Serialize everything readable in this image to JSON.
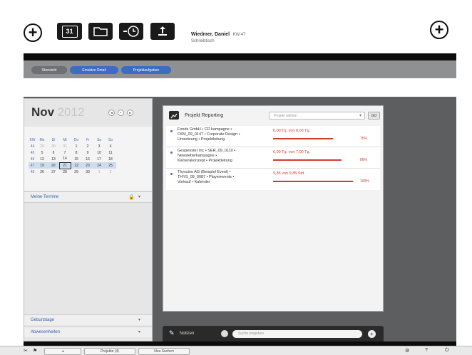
{
  "user": {
    "name": "Wiedmer, Daniel",
    "sub": "Schreibtisch",
    "tag": "KW 47"
  },
  "toolbar": {
    "calendar_day": "31"
  },
  "pills": [
    "Übersicht",
    "Einsätze Detail",
    "Projektaufgaben"
  ],
  "calendar": {
    "month": "Nov",
    "year": "2012",
    "headers": [
      "KW",
      "Mo",
      "Di",
      "Mi",
      "Do",
      "Fr",
      "Sa",
      "So"
    ],
    "rows": [
      [
        "44",
        "29",
        "30",
        "31",
        "1",
        "2",
        "3",
        "4"
      ],
      [
        "45",
        "5",
        "6",
        "7",
        "8",
        "9",
        "10",
        "11"
      ],
      [
        "46",
        "12",
        "13",
        "14",
        "15",
        "16",
        "17",
        "18"
      ],
      [
        "47",
        "19",
        "20",
        "21",
        "22",
        "23",
        "24",
        "25"
      ],
      [
        "48",
        "26",
        "27",
        "28",
        "29",
        "30",
        "1",
        "2"
      ]
    ]
  },
  "left": {
    "meine_termine": "Meine Termine",
    "geburtstage": "Geburtstage",
    "abwesenheiten": "Abwesenheiten"
  },
  "reporting": {
    "title": "Projekt Reporting",
    "select_placeholder": "Projekt wählen",
    "go_label": "GO",
    "items": [
      {
        "line1": "Fonds GmbH • CD kampagne •",
        "line2": "FKM_09_0147 • Corporate Design •",
        "line3": "Umsetzung • Projektleitung",
        "value": "6,00 Tg. von 8,00 Tg.",
        "pct": "75%",
        "fill": 0.75
      },
      {
        "line1": "Gespenster Inc • SER_09_0110 •",
        "line2": "Newsletterkampagne •",
        "line3": "Kamerakonzept • Projektleitung",
        "value": "6,00 Tg. von 7,00 Tg.",
        "pct": "86%",
        "fill": 0.86
      },
      {
        "line1": "Thyssine AG (Beispiel Event) •",
        "line2": "THYS_09_0087 • Playerevents •",
        "line3": "Vorkauf • Kalender",
        "value": "9,85 von 9,85 Std.",
        "pct": "100%",
        "fill": 1.0
      }
    ]
  },
  "bottom": {
    "notes_label": "Notizen",
    "search_placeholder": "Suche eingeben"
  },
  "status": {
    "projekt_btn": "Projekte (4)",
    "neu_btn": "Neu Suchen"
  }
}
